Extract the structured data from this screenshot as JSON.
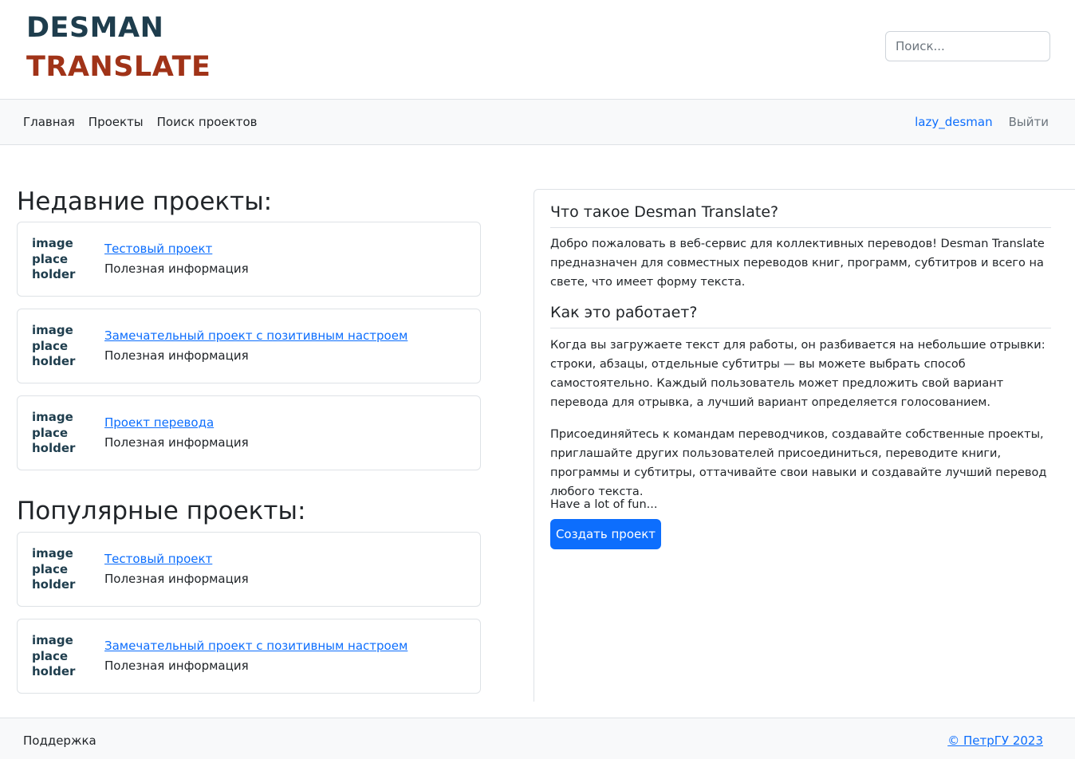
{
  "header": {
    "logo_line1": "DESMAN",
    "logo_line2": "TRANSLATE",
    "search_placeholder": "Поиск..."
  },
  "nav": {
    "items": [
      "Главная",
      "Проекты",
      "Поиск проектов"
    ],
    "user": "lazy_desman",
    "logout": "Выйти"
  },
  "recent": {
    "title": "Недавние проекты:",
    "projects": [
      {
        "thumb": [
          "image",
          "place",
          "holder"
        ],
        "name": "Тестовый проект",
        "info": "Полезная информация"
      },
      {
        "thumb": [
          "image",
          "place",
          "holder"
        ],
        "name": "Замечательный проект с позитивным настроем",
        "info": "Полезная информация"
      },
      {
        "thumb": [
          "image",
          "place",
          "holder"
        ],
        "name": "Проект перевода",
        "info": "Полезная информация"
      }
    ]
  },
  "popular": {
    "title": "Популярные проекты:",
    "projects": [
      {
        "thumb": [
          "image",
          "place",
          "holder"
        ],
        "name": "Тестовый проект",
        "info": "Полезная информация"
      },
      {
        "thumb": [
          "image",
          "place",
          "holder"
        ],
        "name": "Замечательный проект с позитивным настроем",
        "info": "Полезная информация"
      }
    ]
  },
  "about": {
    "heading1": "Что такое Desman Translate?",
    "para1": "Добро пожаловать в веб-сервис для коллективных переводов! Desman Translate предназначен для совместных переводов книг, программ, субтитров и всего на свете, что имеет форму текста.",
    "heading2": "Как это работает?",
    "para2": "Когда вы загружаете текст для работы, он разбивается на небольшие отрывки: строки, абзацы, отдельные субтитры — вы можете выбрать способ самостоятельно. Каждый пользователь может предложить свой вариант перевода для отрывка, а лучший вариант определяется голосованием.",
    "para3": "Присоединяйтесь к командам переводчиков, создавайте собственные проекты, приглашайте других пользователей присоединиться, переводите книги, программы и субтитры, оттачивайте свои навыки и создавайте лучший перевод любого текста.",
    "para4": "Have a lot of fun...",
    "button": "Создать проект"
  },
  "footer": {
    "support": "Поддержка",
    "copyright": "© ПетрГУ 2023"
  },
  "colors": {
    "logo_dark": "#1e3d4d",
    "logo_accent": "#a03318",
    "link": "#0d6efd",
    "button": "#0d6efd"
  }
}
